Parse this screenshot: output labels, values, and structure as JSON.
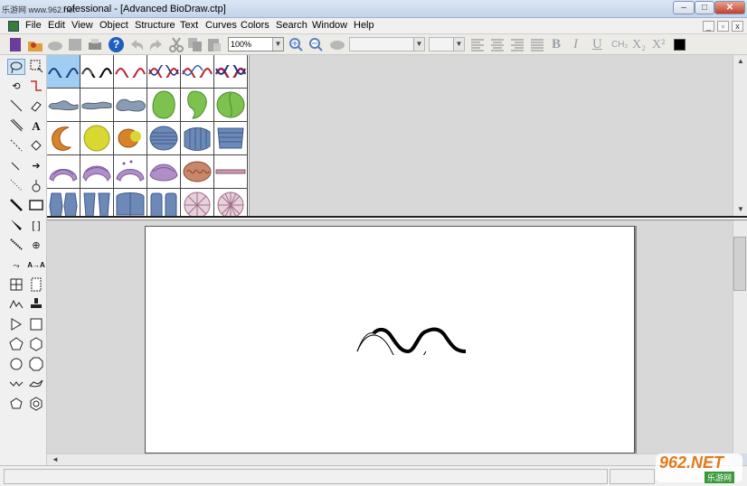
{
  "window": {
    "title": "rofessional - [Advanced BioDraw.ctp]",
    "site_logo_text": "乐游网 www.962.net"
  },
  "menu": {
    "items": [
      "File",
      "Edit",
      "View",
      "Object",
      "Structure",
      "Text",
      "Curves",
      "Colors",
      "Search",
      "Window",
      "Help"
    ]
  },
  "toolbar": {
    "zoom_value": "100%",
    "subscript_label": "X₂",
    "superscript_label": "X²",
    "ch2_label": "CH₂",
    "bold_label": "B",
    "italic_label": "I",
    "underline_label": "U",
    "help_label": "?"
  },
  "tools": {
    "text_tool_label": "A",
    "text_size_label": "A→A"
  },
  "watermark": {
    "brand": "962.NET",
    "sub": "乐游网"
  },
  "colors": {
    "selected_cell": "#9fcdf3",
    "shape_green": "#7dc24e",
    "shape_yellow": "#d8d830",
    "shape_orange": "#d8822a",
    "shape_blue_grey": "#8a9bb5",
    "shape_violet": "#b08fc8",
    "shape_blue": "#6c89b8",
    "shape_pink": "#c79ab0"
  }
}
